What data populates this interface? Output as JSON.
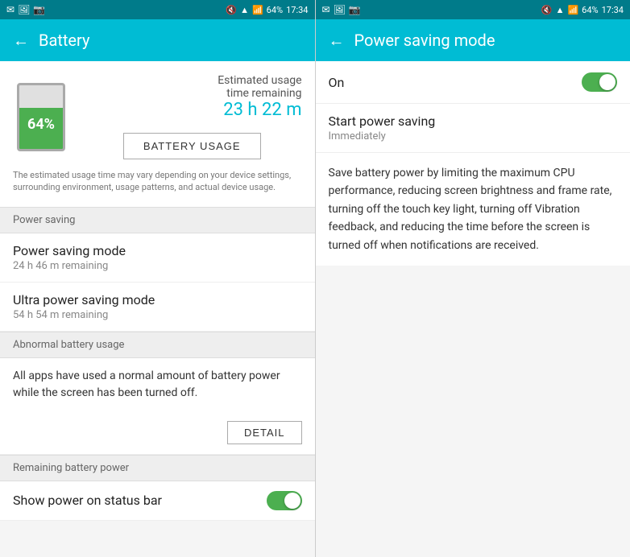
{
  "left_panel": {
    "status_bar": {
      "left_icons": [
        "msg-icon",
        "photo-icon",
        "screenshot-icon"
      ],
      "right": {
        "mute": "🔇",
        "wifi": "WiFi",
        "signal": "📶",
        "battery_pct": "64%",
        "time": "17:34"
      }
    },
    "header": {
      "back_label": "←",
      "title": "Battery"
    },
    "battery": {
      "percent": "64%",
      "fill_height": "64%",
      "estimated_label": "Estimated usage",
      "time_label": "time remaining",
      "time_value": "23 h 22 m",
      "usage_btn_label": "BATTERY USAGE",
      "note": "The estimated usage time may vary depending on your device settings, surrounding environment, usage patterns, and actual device usage."
    },
    "section_power_saving": {
      "label": "Power saving"
    },
    "power_saving_mode": {
      "title": "Power saving mode",
      "subtitle": "24 h 46 m remaining"
    },
    "ultra_power_saving": {
      "title": "Ultra power saving mode",
      "subtitle": "54 h 54 m remaining"
    },
    "section_abnormal": {
      "label": "Abnormal battery usage"
    },
    "abnormal_text": "All apps have used a normal amount of battery power while the screen has been turned off.",
    "detail_btn_label": "DETAIL",
    "section_remaining": {
      "label": "Remaining battery power"
    },
    "show_power": {
      "title": "Show power on status bar",
      "toggle_on": true
    }
  },
  "right_panel": {
    "status_bar": {
      "left_icons": [
        "msg-icon",
        "photo-icon",
        "screenshot-icon"
      ],
      "right": {
        "mute": "🔇",
        "wifi": "WiFi",
        "signal": "📶",
        "battery_pct": "64%",
        "time": "17:34"
      }
    },
    "header": {
      "back_label": "←",
      "title": "Power saving mode"
    },
    "on_label": "On",
    "toggle_on": true,
    "start_saving_title": "Start power saving",
    "start_saving_subtitle": "Immediately",
    "description": "Save battery power by limiting the maximum CPU performance, reducing screen brightness and frame rate, turning off the touch key light, turning off Vibration feedback, and reducing the time before the screen is turned off when notifications are received."
  }
}
